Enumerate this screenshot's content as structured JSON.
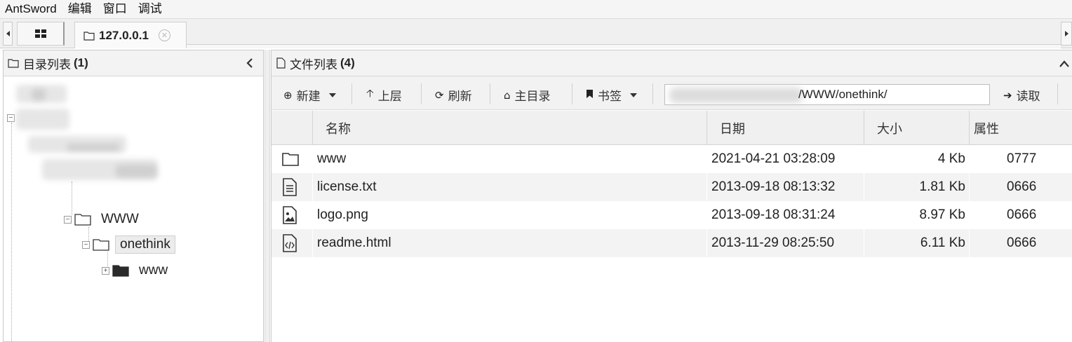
{
  "menubar": {
    "items": [
      "AntSword",
      "编辑",
      "窗口",
      "调试"
    ]
  },
  "tabs": {
    "active_label": "127.0.0.1"
  },
  "left_panel": {
    "title": "目录列表",
    "count": "(1)",
    "tree": [
      {
        "label": "WWW"
      },
      {
        "label": "onethink"
      },
      {
        "label": "www"
      }
    ]
  },
  "right_panel": {
    "title": "文件列表",
    "count": "(4)",
    "toolbar": {
      "new_label": "新建",
      "up_label": "上层",
      "refresh_label": "刷新",
      "home_label": "主目录",
      "bookmark_label": "书签",
      "path_value": "/WWW/onethink/",
      "read_label": "读取"
    },
    "columns": [
      "名称",
      "日期",
      "大小",
      "属性"
    ],
    "files": [
      {
        "icon": "folder-icon",
        "name": "www",
        "date": "2021-04-21 03:28:09",
        "size": "4 Kb",
        "attr": "0777"
      },
      {
        "icon": "text-file-icon",
        "name": "license.txt",
        "date": "2013-09-18 08:13:32",
        "size": "1.81 Kb",
        "attr": "0666"
      },
      {
        "icon": "image-file-icon",
        "name": "logo.png",
        "date": "2013-09-18 08:31:24",
        "size": "8.97 Kb",
        "attr": "0666"
      },
      {
        "icon": "code-file-icon",
        "name": "readme.html",
        "date": "2013-11-29 08:25:50",
        "size": "6.11 Kb",
        "attr": "0666"
      }
    ]
  }
}
